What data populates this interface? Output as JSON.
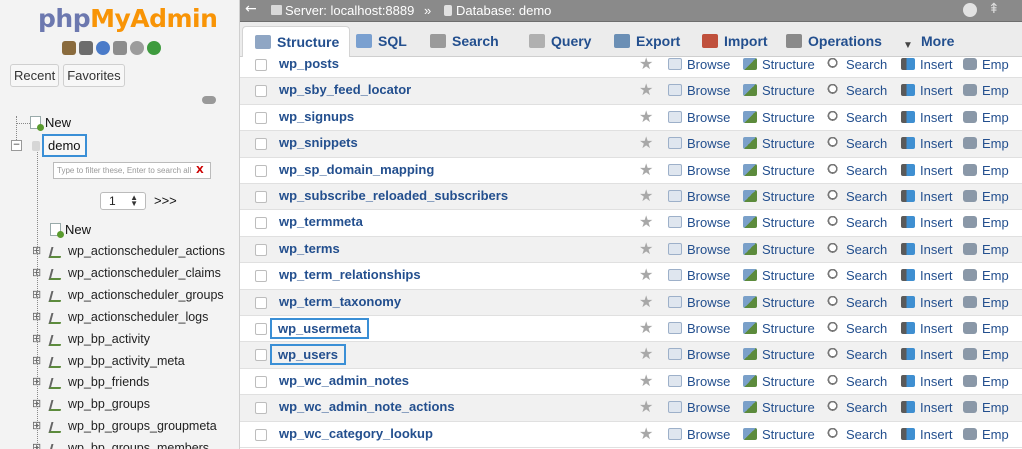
{
  "sidebar": {
    "logo": {
      "part1": "php",
      "part2": "MyAdmin"
    },
    "quick_icons": [
      "home-icon",
      "exit-icon",
      "help-icon",
      "docs-icon",
      "settings-icon",
      "reload-icon"
    ],
    "tabs": [
      "Recent",
      "Favorites"
    ],
    "new_root": "New",
    "database": "demo",
    "filter_placeholder": "Type to filter these, Enter to search all",
    "filter_clear": "X",
    "pager_value": "1",
    "pager_next": ">>>",
    "new_table": "New",
    "tables": [
      "wp_actionscheduler_actions",
      "wp_actionscheduler_claims",
      "wp_actionscheduler_groups",
      "wp_actionscheduler_logs",
      "wp_bp_activity",
      "wp_bp_activity_meta",
      "wp_bp_friends",
      "wp_bp_groups",
      "wp_bp_groups_groupmeta",
      "wp_bp_groups_members"
    ]
  },
  "topbar": {
    "back": "←",
    "server": "Server: localhost:8889",
    "separator": "»",
    "database": "Database: demo"
  },
  "tabs": [
    {
      "label": "Structure",
      "icon": "structure-icon",
      "active": true
    },
    {
      "label": "SQL",
      "icon": "sql-icon"
    },
    {
      "label": "Search",
      "icon": "search-icon"
    },
    {
      "label": "Query",
      "icon": "query-icon"
    },
    {
      "label": "Export",
      "icon": "export-icon"
    },
    {
      "label": "Import",
      "icon": "import-icon"
    },
    {
      "label": "Operations",
      "icon": "operations-icon"
    },
    {
      "label": "More",
      "icon": "chevron-down-icon"
    }
  ],
  "actions": {
    "browse": "Browse",
    "structure": "Structure",
    "search": "Search",
    "insert": "Insert",
    "empty": "Emp"
  },
  "tables": [
    {
      "name": "wp_posts",
      "highlighted": false
    },
    {
      "name": "wp_sby_feed_locator",
      "highlighted": false
    },
    {
      "name": "wp_signups",
      "highlighted": false
    },
    {
      "name": "wp_snippets",
      "highlighted": false
    },
    {
      "name": "wp_sp_domain_mapping",
      "highlighted": false
    },
    {
      "name": "wp_subscribe_reloaded_subscribers",
      "highlighted": false
    },
    {
      "name": "wp_termmeta",
      "highlighted": false
    },
    {
      "name": "wp_terms",
      "highlighted": false
    },
    {
      "name": "wp_term_relationships",
      "highlighted": false
    },
    {
      "name": "wp_term_taxonomy",
      "highlighted": false
    },
    {
      "name": "wp_usermeta",
      "highlighted": true
    },
    {
      "name": "wp_users",
      "highlighted": true
    },
    {
      "name": "wp_wc_admin_notes",
      "highlighted": false
    },
    {
      "name": "wp_wc_admin_note_actions",
      "highlighted": false
    },
    {
      "name": "wp_wc_category_lookup",
      "highlighted": false
    }
  ],
  "colors": {
    "link": "#234f8e",
    "highlight_box": "#3a8fd6",
    "logo_php": "#6c78af",
    "logo_myadmin": "#f89406"
  }
}
